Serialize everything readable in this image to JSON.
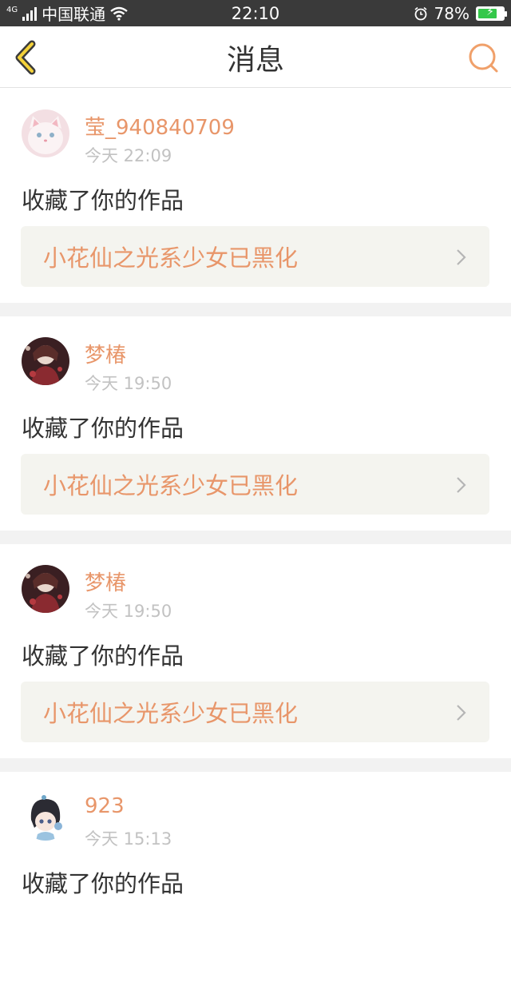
{
  "status_bar": {
    "network": "4G",
    "carrier": "中国联通",
    "time": "22:10",
    "battery": "78%",
    "battery_level": 0.78
  },
  "header": {
    "title": "消息",
    "icons": {
      "back": "back-chevron-icon",
      "search": "search-icon"
    }
  },
  "messages": [
    {
      "username": "莹_940840709",
      "time": "今天 22:09",
      "action": "收藏了你的作品",
      "work_title": "小花仙之光系少女已黑化",
      "avatar": "white-cat-avatar"
    },
    {
      "username": "梦椿",
      "time": "今天 19:50",
      "action": "收藏了你的作品",
      "work_title": "小花仙之光系少女已黑化",
      "avatar": "dark-anime-avatar"
    },
    {
      "username": "梦椿",
      "time": "今天 19:50",
      "action": "收藏了你的作品",
      "work_title": "小花仙之光系少女已黑化",
      "avatar": "dark-anime-avatar"
    },
    {
      "username": "923",
      "time": "今天 15:13",
      "action": "收藏了你的作品",
      "work_title": "",
      "avatar": "chibi-girl-avatar"
    }
  ],
  "colors": {
    "accent": "#e8966a",
    "status_bar_bg": "#3a3a3a",
    "divider": "#f2f2f2",
    "work_box_bg": "#f4f4ef"
  }
}
